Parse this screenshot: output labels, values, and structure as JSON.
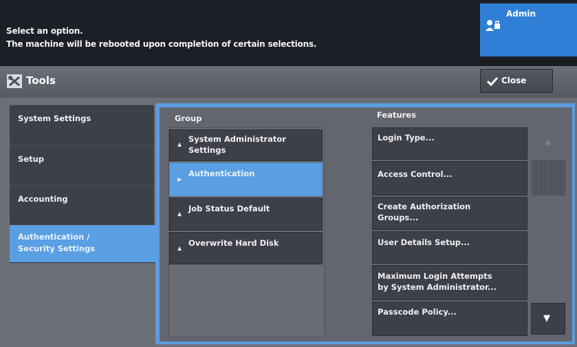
{
  "message": {
    "line1": "Select an option.",
    "line2": "The machine will be rebooted upon completion of certain selections."
  },
  "user": {
    "label": "Admin",
    "icon": "admin-user-icon"
  },
  "titlebar": {
    "title": "Tools",
    "icon": "tools-icon",
    "close_label": "Close"
  },
  "tabs": [
    {
      "label": "System Settings"
    },
    {
      "label": "Setup"
    },
    {
      "label": "Accounting"
    },
    {
      "label_line1": "Authentication /",
      "label_line2": "Security Settings",
      "active": true
    }
  ],
  "group": {
    "header": "Group",
    "items": [
      {
        "label_line1": "System Administrator",
        "label_line2": "Settings"
      },
      {
        "label": "Authentication",
        "selected": true
      },
      {
        "label": "Job Status Default"
      },
      {
        "label": "Overwrite Hard Disk"
      }
    ]
  },
  "features": {
    "header": "Features",
    "items": [
      {
        "label": "Login Type..."
      },
      {
        "label": "Access Control..."
      },
      {
        "label_line1": "Create Authorization",
        "label_line2": "Groups..."
      },
      {
        "label": "User Details Setup..."
      },
      {
        "label_line1": "Maximum Login Attempts",
        "label_line2": "by System Administrator..."
      },
      {
        "label": "Passcode Policy..."
      }
    ]
  },
  "scroll": {
    "up_icon": "▲",
    "down_icon": "▼"
  },
  "colors": {
    "accent": "#5b9fe3",
    "admin": "#2f7fd6"
  }
}
